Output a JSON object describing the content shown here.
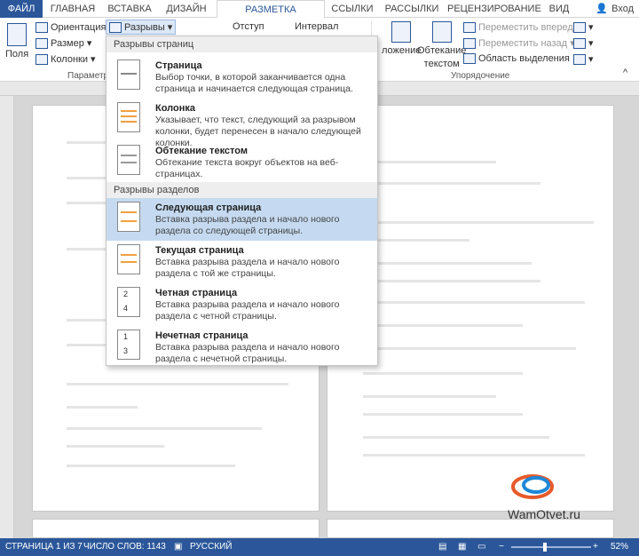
{
  "tabs": [
    "ФАЙЛ",
    "ГЛАВНАЯ",
    "ВСТАВКА",
    "ДИЗАЙН",
    "РАЗМЕТКА СТРАНИЦЫ",
    "ССЫЛКИ",
    "РАССЫЛКИ",
    "РЕЦЕНЗИРОВАНИЕ",
    "ВИД"
  ],
  "signin": "Вход",
  "ribbon": {
    "margins": "Поля",
    "orientation": "Ориентация",
    "size": "Размер",
    "columns": "Колонки",
    "breaks": "Разрывы",
    "group_params": "Параметр",
    "indent": "Отступ",
    "spacing": "Интервал",
    "position": "ложение",
    "wrap1": "Обтекание",
    "wrap2": "текстом",
    "forward": "Переместить вперед",
    "backward": "Переместить назад",
    "selection_pane": "Область выделения",
    "group_arrange": "Упорядочение"
  },
  "dropdown": {
    "page_breaks": "Разрывы страниц",
    "section_breaks": "Разрывы разделов",
    "items": [
      {
        "title": "Страница",
        "desc": "Выбор точки, в которой заканчивается одна страница и начинается следующая страница."
      },
      {
        "title": "Колонка",
        "desc": "Указывает, что текст, следующий за разрывом колонки, будет перенесен в начало следующей колонки."
      },
      {
        "title": "Обтекание текстом",
        "desc": "Обтекание текста вокруг объектов на веб-страницах."
      },
      {
        "title": "Следующая страница",
        "desc": "Вставка разрыва раздела и начало нового раздела со следующей страницы."
      },
      {
        "title": "Текущая страница",
        "desc": "Вставка разрыва раздела и начало нового раздела с той же страницы."
      },
      {
        "title": "Четная страница",
        "desc": "Вставка разрыва раздела и начало нового раздела с четной страницы."
      },
      {
        "title": "Нечетная страница",
        "desc": "Вставка разрыва раздела и начало нового раздела с нечетной страницы."
      }
    ],
    "icon_nums": [
      "2",
      "4",
      "1",
      "3"
    ]
  },
  "status": {
    "page": "СТРАНИЦА 1 ИЗ 7",
    "words": "ЧИСЛО СЛОВ: 1143",
    "lang": "РУССКИЙ",
    "zoom": "52%"
  },
  "watermark": "WamOtvet.ru",
  "colors": {
    "accent": "#2b579a",
    "highlight": "#c5daf0"
  }
}
